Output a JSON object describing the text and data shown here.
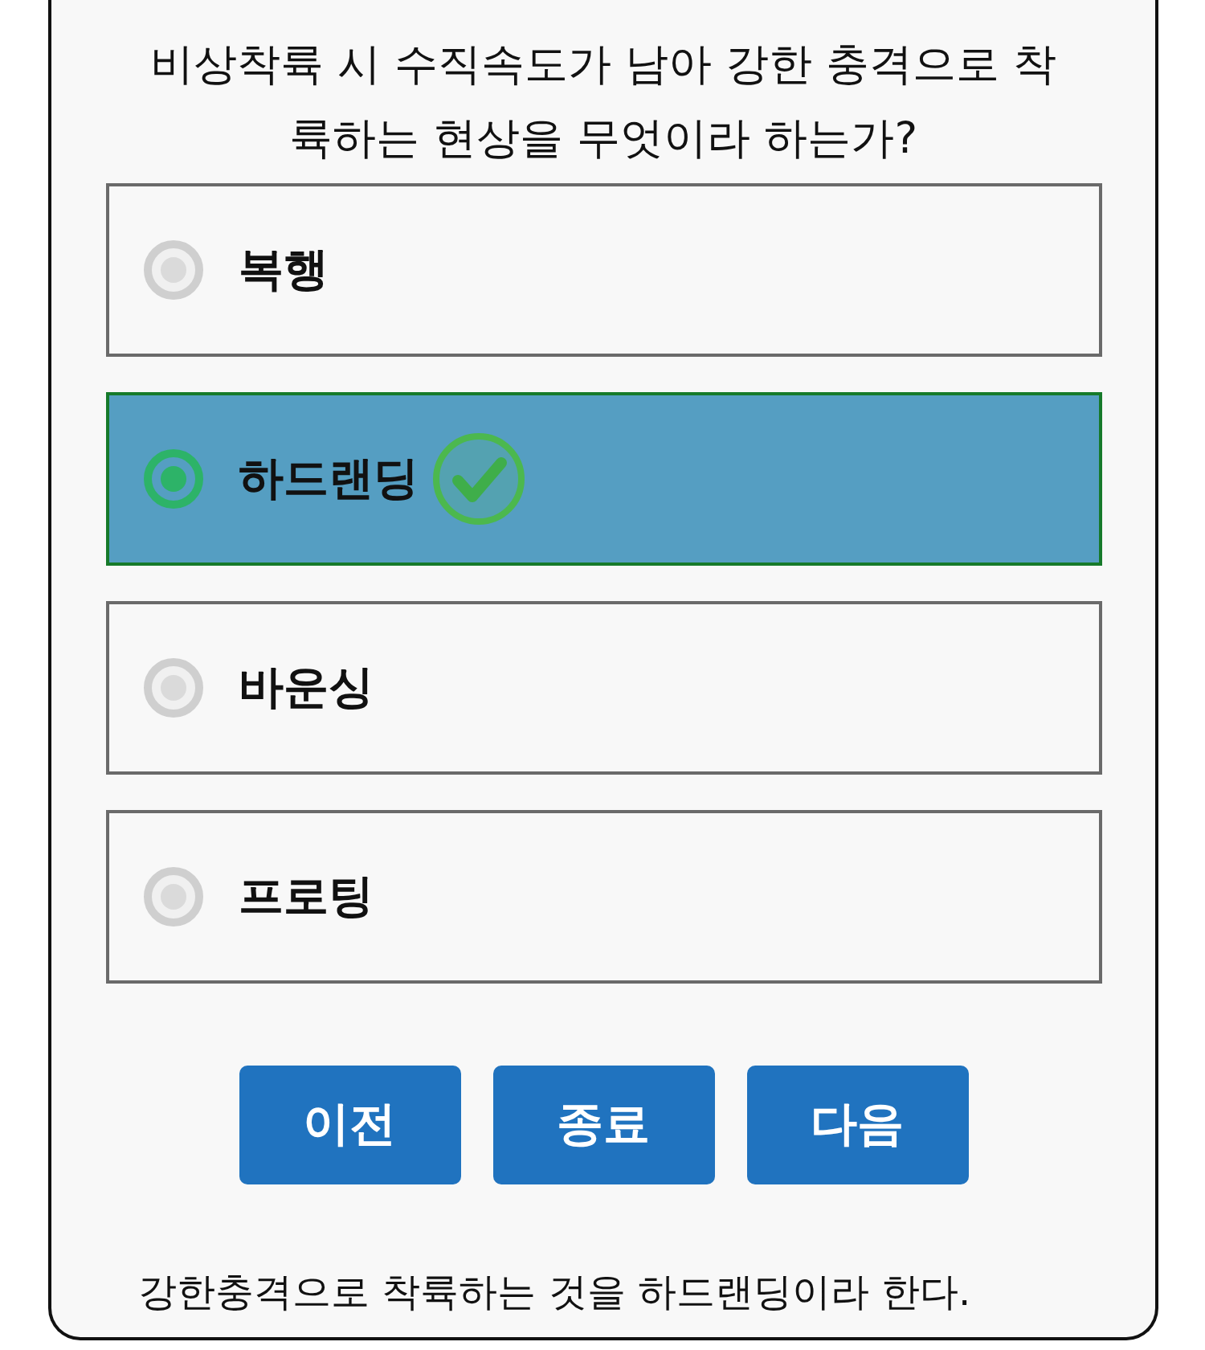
{
  "question": "비상착륙 시 수직속도가 남아 강한 충격으로 착륙하는 현상을 무엇이라 하는가?",
  "options": [
    {
      "label": "복행",
      "selected": false,
      "correct": false
    },
    {
      "label": "하드랜딩",
      "selected": true,
      "correct": true
    },
    {
      "label": "바운싱",
      "selected": false,
      "correct": false
    },
    {
      "label": "프로팅",
      "selected": false,
      "correct": false
    }
  ],
  "buttons": [
    {
      "label": "이전"
    },
    {
      "label": "종료"
    },
    {
      "label": "다음"
    }
  ],
  "explanation": "강한충격으로 착륙하는 것을 하드랜딩이라 한다."
}
